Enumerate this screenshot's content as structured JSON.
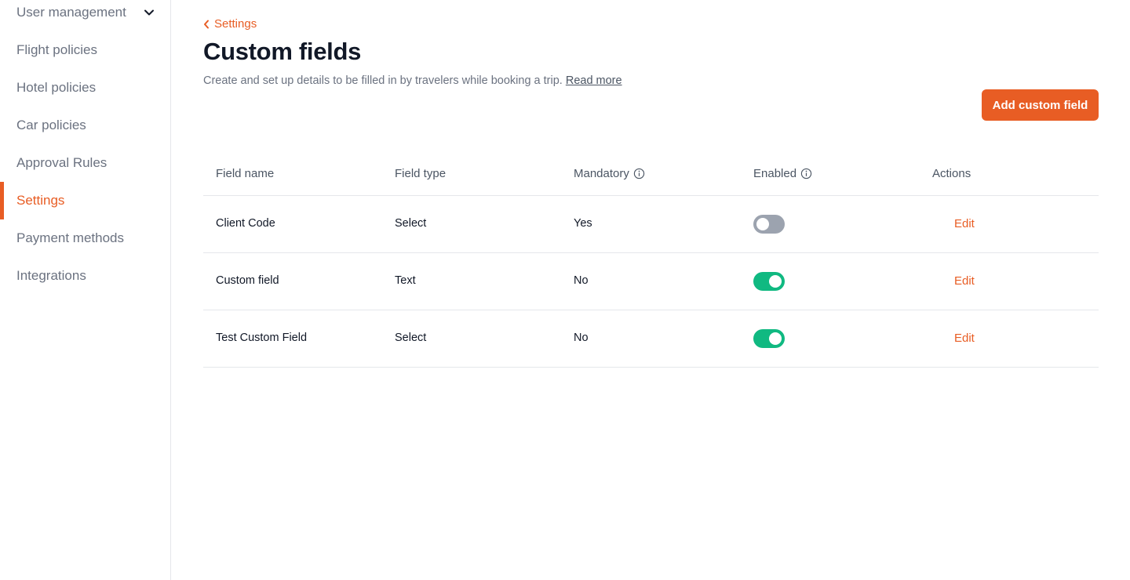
{
  "sidebar": {
    "items": [
      {
        "label": "User management",
        "icon": "chevron-down-icon"
      },
      {
        "label": "Flight policies"
      },
      {
        "label": "Hotel policies"
      },
      {
        "label": "Car policies"
      },
      {
        "label": "Approval Rules"
      },
      {
        "label": "Settings",
        "active": true
      },
      {
        "label": "Payment methods"
      },
      {
        "label": "Integrations"
      }
    ]
  },
  "header": {
    "back_label": "Settings",
    "title": "Custom fields",
    "description": "Create and set up details to be filled in by travelers while booking a trip.",
    "read_more": "Read more",
    "add_button": "Add custom field"
  },
  "table": {
    "columns": [
      "Field name",
      "Field type",
      "Mandatory",
      "Enabled",
      "Actions"
    ],
    "rows": [
      {
        "name": "Client Code",
        "type": "Select",
        "mandatory": "Yes",
        "enabled": false,
        "action": "Edit"
      },
      {
        "name": "Custom field",
        "type": "Text",
        "mandatory": "No",
        "enabled": true,
        "action": "Edit"
      },
      {
        "name": "Test Custom Field",
        "type": "Select",
        "mandatory": "No",
        "enabled": true,
        "action": "Edit"
      }
    ]
  },
  "colors": {
    "accent": "#e85d24",
    "toggle_on": "#10b981",
    "toggle_off": "#9ca3af"
  }
}
